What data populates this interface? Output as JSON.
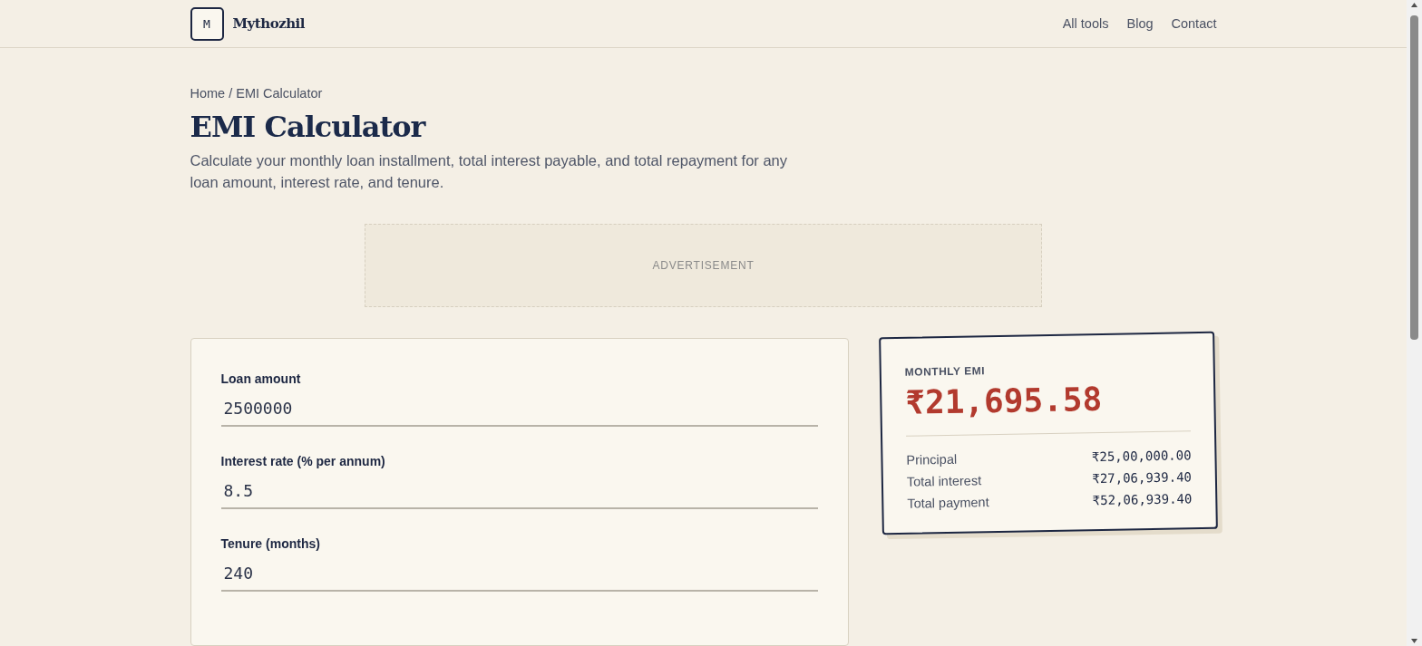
{
  "header": {
    "logo_mark": "M",
    "brand": "Mythozhil",
    "nav": [
      "All tools",
      "Blog",
      "Contact"
    ]
  },
  "breadcrumb": "Home / EMI Calculator",
  "title": "EMI Calculator",
  "description": "Calculate your monthly loan installment, total interest payable, and total repayment for any loan amount, interest rate, and tenure.",
  "ad": {
    "label": "ADVERTISEMENT"
  },
  "form": {
    "fields": [
      {
        "label": "Loan amount",
        "value": "2500000"
      },
      {
        "label": "Interest rate (% per annum)",
        "value": "8.5"
      },
      {
        "label": "Tenure (months)",
        "value": "240"
      }
    ]
  },
  "result": {
    "label": "MONTHLY EMI",
    "amount": "₹21,695.58",
    "rows": [
      {
        "name": "Principal",
        "value": "₹25,00,000.00"
      },
      {
        "name": "Total interest",
        "value": "₹27,06,939.40"
      },
      {
        "name": "Total payment",
        "value": "₹52,06,939.40"
      }
    ]
  }
}
